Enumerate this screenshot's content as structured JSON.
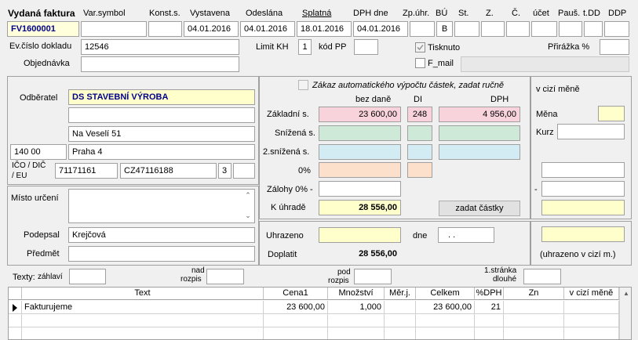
{
  "header": {
    "title": "Vydaná faktura",
    "labels": {
      "var_symbol": "Var.symbol",
      "konst_s": "Konst.s.",
      "vystavena": "Vystavena",
      "odeslana": "Odeslána",
      "splatna": "Splatná",
      "dph_dne": "DPH dne",
      "zp_uhr": "Zp.úhr.",
      "bu": "BÚ",
      "st": "St.",
      "z": "Z.",
      "c": "Č.",
      "ucet": "účet",
      "paus": "Pauš.",
      "tdd": "t.DD",
      "ddp": "DDP"
    },
    "values": {
      "cislo": "FV1600001",
      "var_symbol": "",
      "konst_s": "",
      "vystavena": "04.01.2016",
      "odeslana": "04.01.2016",
      "splatna": "18.01.2016",
      "dph_dne": "04.01.2016",
      "zp_uhr": "",
      "bu": "B"
    }
  },
  "row2": {
    "ev_cislo_label": "Ev.číslo dokladu",
    "ev_cislo_value": "12546",
    "objednavka_label": "Objednávka",
    "objednavka_value": "",
    "limit_kh_label": "Limit KH",
    "limit_kh_value": "1",
    "kod_pp_label": "kód PP",
    "kod_pp_value": "",
    "tisknuto_label": "Tisknuto",
    "f_mail_label": "F_mail",
    "prirazka_label": "Přirážka %",
    "prirazka_value": ""
  },
  "odberatel": {
    "label": "Odběratel",
    "name": "DS STAVEBNÍ VÝROBA",
    "line2": "",
    "street": "Na Veselí 51",
    "psc": "140 00",
    "city": "Praha 4",
    "ico_label": "IČO / DIČ",
    "eu_label": "/ EU",
    "ico": "71171161",
    "dic": "CZ47116188",
    "eu": "3"
  },
  "misto": {
    "misto_label": "Místo určení",
    "podepsal_label": "Podepsal",
    "podepsal_value": "Krejčová",
    "predmet_label": "Předmět",
    "predmet_value": ""
  },
  "vat": {
    "zakaz_label": "Zákaz automatického výpočtu částek, zadat ručně",
    "col_bez_dane": "bez daně",
    "col_di": "DI",
    "col_dph": "DPH",
    "zakladni_label": "Základní s.",
    "zakladni_bez": "23 600,00",
    "zakladni_di": "248",
    "zakladni_dph": "4 956,00",
    "snizena_label": "Snížená s.",
    "snizena2_label": "2.snížená s.",
    "nula_label": "0%",
    "zalohy_label": "Zálohy 0% -",
    "k_uhrade_label": "K úhradě",
    "k_uhrade_value": "28 556,00",
    "zadat_button": "zadat částky"
  },
  "foreign": {
    "title": "v cizí měně",
    "mena_label": "Měna",
    "kurz_label": "Kurz",
    "minus_label": "-",
    "note": "(uhrazeno v cizí m.)"
  },
  "payment": {
    "uhrazeno_label": "Uhrazeno",
    "dne_label": "dne",
    "dne_value": ". .",
    "doplatit_label": "Doplatit",
    "doplatit_value": "28 556,00"
  },
  "texts": {
    "texty_label": "Texty:",
    "zahlavi_label": "záhlaví",
    "nad_label": "nad",
    "rozpis_label": "rozpis",
    "pod_label": "pod",
    "rozpis2_label": "rozpis",
    "stranka_label": "1.stránka",
    "dlouhe_label": "dlouhé"
  },
  "table": {
    "columns": [
      "Text",
      "Cena1",
      "Množství",
      "Měr.j.",
      "Celkem",
      "%DPH",
      "Zn",
      "v cizí měně"
    ],
    "rows": [
      {
        "text": "Fakturujeme",
        "cena1": "23 600,00",
        "mnozstvi": "1,000",
        "merj": "",
        "celkem": "23 600,00",
        "dph": "21",
        "zn": "",
        "cizi": ""
      }
    ]
  }
}
